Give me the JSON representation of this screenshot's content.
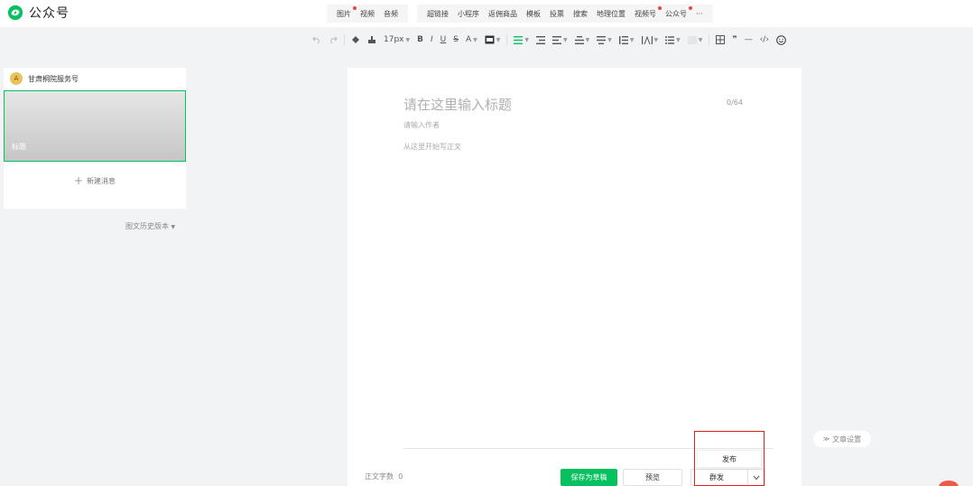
{
  "header": {
    "app_title": "公众号",
    "insert_menu": {
      "media": [
        {
          "label": "图片",
          "dot": true
        },
        {
          "label": "视频",
          "dot": false
        },
        {
          "label": "音频",
          "dot": false
        }
      ],
      "content": [
        {
          "label": "超链接",
          "dot": false
        },
        {
          "label": "小程序",
          "dot": false
        },
        {
          "label": "返佣商品",
          "dot": false
        },
        {
          "label": "模板",
          "dot": false
        },
        {
          "label": "投票",
          "dot": false
        },
        {
          "label": "搜索",
          "dot": false
        },
        {
          "label": "地理位置",
          "dot": false
        },
        {
          "label": "视频号",
          "dot": true
        },
        {
          "label": "公众号",
          "dot": true
        },
        {
          "label": "···",
          "dot": false
        }
      ]
    }
  },
  "toolbar": {
    "font_size": "17px",
    "bold": "B",
    "italic": "I",
    "underline": "U",
    "strikethrough": "S",
    "font_color": "A"
  },
  "left_panel": {
    "account_name": "甘肃桐院服务号",
    "avatar_text": "A",
    "article_card_title": "标题",
    "new_message_label": "新建消息",
    "history_version_label": "图文历史版本"
  },
  "editor": {
    "title_placeholder": "请在这里输入标题",
    "title_count": "0/64",
    "author_placeholder": "请输入作者",
    "body_placeholder": "从这里开始写正文"
  },
  "bottom_bar": {
    "word_count_label": "正文字数",
    "word_count": "0",
    "save_draft_label": "保存为草稿",
    "preview_label": "预览",
    "mass_send_label": "群发",
    "publish_label": "发布"
  },
  "article_settings_label": "文章设置",
  "colors": {
    "brand_green": "#07c160",
    "highlight_red": "#e62117",
    "notification_dot": "#e54545"
  }
}
